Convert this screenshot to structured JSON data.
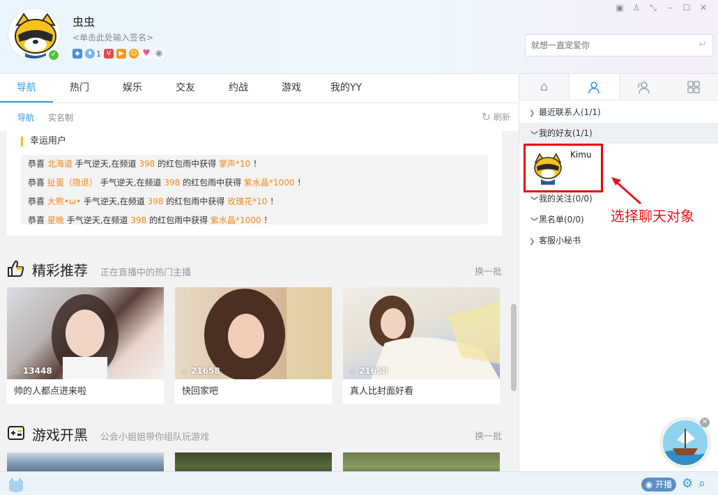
{
  "profile": {
    "username": "虫虫",
    "signature": "<单击此处输入签名>",
    "badge_count": "1"
  },
  "search": {
    "placeholder": "就想一直宠爱你"
  },
  "nav_tabs": [
    "导航",
    "热门",
    "娱乐",
    "交友",
    "约战",
    "游戏",
    "我的YY"
  ],
  "sub_tabs": [
    "导航",
    "实名制"
  ],
  "refresh_label": "刷新",
  "lucky": {
    "title": "幸运用户",
    "lines": [
      {
        "prefix": "恭喜",
        "user": "北海道",
        "mid": "手气逆天,在频道",
        "channel": "398",
        "mid2": "的红包雨中获得",
        "prize": "掌声*10",
        "end": "！"
      },
      {
        "prefix": "恭喜",
        "user": "扯蛋（隐退）",
        "mid": "手气逆天,在频道",
        "channel": "398",
        "mid2": "的红包雨中获得",
        "prize": "紫水晶*1000",
        "end": "！"
      },
      {
        "prefix": "恭喜",
        "user": "大熊•ω•",
        "mid": "手气逆天,在频道",
        "channel": "398",
        "mid2": "的红包雨中获得",
        "prize": "玫瑰花*10",
        "end": "！"
      },
      {
        "prefix": "恭喜",
        "user": "星晚",
        "mid": "手气逆天,在频道",
        "channel": "398",
        "mid2": "的红包雨中获得",
        "prize": "紫水晶*1000",
        "end": "！"
      }
    ]
  },
  "recommend": {
    "title": "精彩推荐",
    "subtitle": "正在直播中的热门主播",
    "more": "换一批",
    "cards": [
      {
        "viewers": "13448",
        "title": "帅的人都点进来啦"
      },
      {
        "viewers": "21658",
        "title": "快回家吧"
      },
      {
        "viewers": "21658",
        "title": "真人比封面好看"
      }
    ]
  },
  "games": {
    "title": "游戏开黑",
    "subtitle": "公会小姐姐带你组队玩游戏",
    "more": "换一批"
  },
  "contacts": {
    "groups": [
      {
        "label": "最近联系人(1/1)",
        "expanded": false
      },
      {
        "label": "我的好友(1/1)",
        "expanded": true
      },
      {
        "label": "我的关注(0/0)",
        "expanded": true
      },
      {
        "label": "黑名单(0/0)",
        "expanded": true
      },
      {
        "label": "客服小秘书",
        "expanded": false
      }
    ],
    "friend_name": "Kimu"
  },
  "annotation": "选择聊天对象",
  "footer": {
    "live_label": "开播"
  },
  "colors": {
    "accent": "#2e9be6",
    "highlight": "#f08a1d",
    "annotation": "#e8141c"
  }
}
